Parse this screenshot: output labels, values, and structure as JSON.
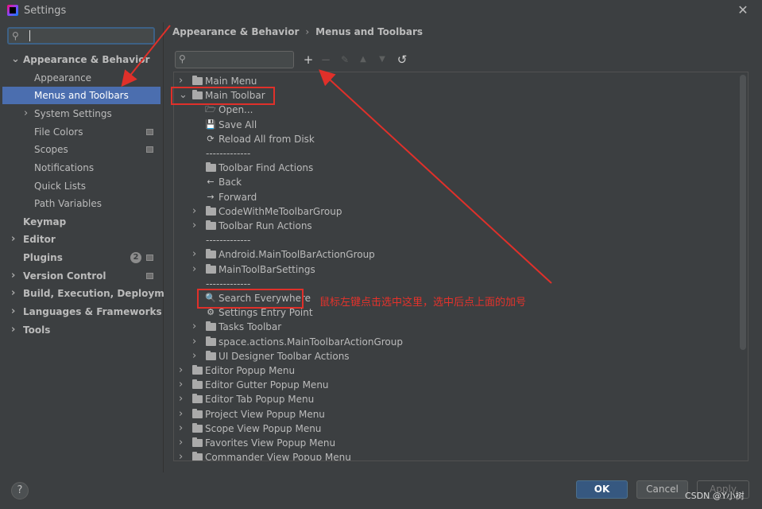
{
  "window": {
    "title": "Settings",
    "close_glyph": "✕"
  },
  "left": {
    "search_icon": "search-icon",
    "nav": [
      {
        "label": "Appearance & Behavior",
        "bold": true,
        "expanded": true
      },
      {
        "label": "Appearance"
      },
      {
        "label": "Menus and Toolbars",
        "selected": true
      },
      {
        "label": "System Settings",
        "collapsed": true
      },
      {
        "label": "File Colors",
        "badge": true
      },
      {
        "label": "Scopes",
        "badge": true
      },
      {
        "label": "Notifications"
      },
      {
        "label": "Quick Lists"
      },
      {
        "label": "Path Variables"
      },
      {
        "label": "Keymap",
        "bold": true
      },
      {
        "label": "Editor",
        "bold": true,
        "collapsed": true
      },
      {
        "label": "Plugins",
        "bold": true,
        "help_badge": "2",
        "badge": true
      },
      {
        "label": "Version Control",
        "bold": true,
        "collapsed": true,
        "badge": true
      },
      {
        "label": "Build, Execution, Deployment",
        "bold": true,
        "collapsed": true
      },
      {
        "label": "Languages & Frameworks",
        "bold": true,
        "collapsed": true
      },
      {
        "label": "Tools",
        "bold": true,
        "collapsed": true
      }
    ]
  },
  "right": {
    "breadcrumb": [
      "Appearance & Behavior",
      "Menus and Toolbars"
    ],
    "breadcrumb_sep": "›",
    "toolbar": {
      "add": "+",
      "remove": "−",
      "edit": "✎",
      "up": "▲",
      "down": "▼",
      "restore": "↺"
    },
    "tree": [
      {
        "label": "Main Menu",
        "level": 0,
        "type": "folder",
        "arrow": "collapsed"
      },
      {
        "label": "Main Toolbar",
        "level": 0,
        "type": "folder",
        "arrow": "expanded"
      },
      {
        "label": "Open...",
        "level": 1,
        "type": "open"
      },
      {
        "label": "Save All",
        "level": 1,
        "type": "save"
      },
      {
        "label": "Reload All from Disk",
        "level": 1,
        "type": "reload"
      },
      {
        "label": "-------------",
        "level": 1,
        "type": "sep"
      },
      {
        "label": "Toolbar Find Actions",
        "level": 1,
        "type": "folder"
      },
      {
        "label": "Back",
        "level": 1,
        "type": "back"
      },
      {
        "label": "Forward",
        "level": 1,
        "type": "forward"
      },
      {
        "label": "CodeWithMeToolbarGroup",
        "level": 1,
        "type": "folder",
        "arrow": "collapsed"
      },
      {
        "label": "Toolbar Run Actions",
        "level": 1,
        "type": "folder",
        "arrow": "collapsed"
      },
      {
        "label": "-------------",
        "level": 1,
        "type": "sep"
      },
      {
        "label": "Android.MainToolBarActionGroup",
        "level": 1,
        "type": "folder",
        "arrow": "collapsed"
      },
      {
        "label": "MainToolBarSettings",
        "level": 1,
        "type": "folder",
        "arrow": "collapsed"
      },
      {
        "label": "-------------",
        "level": 1,
        "type": "sep"
      },
      {
        "label": "Search Everywhere",
        "level": 1,
        "type": "search"
      },
      {
        "label": "Settings Entry Point",
        "level": 1,
        "type": "gear"
      },
      {
        "label": "Tasks Toolbar",
        "level": 1,
        "type": "folder",
        "arrow": "collapsed"
      },
      {
        "label": "space.actions.MainToolbarActionGroup",
        "level": 1,
        "type": "folder",
        "arrow": "collapsed"
      },
      {
        "label": "UI Designer Toolbar Actions",
        "level": 1,
        "type": "folder",
        "arrow": "collapsed"
      },
      {
        "label": "Editor Popup Menu",
        "level": 0,
        "type": "folder",
        "arrow": "collapsed"
      },
      {
        "label": "Editor Gutter Popup Menu",
        "level": 0,
        "type": "folder",
        "arrow": "collapsed"
      },
      {
        "label": "Editor Tab Popup Menu",
        "level": 0,
        "type": "folder",
        "arrow": "collapsed"
      },
      {
        "label": "Project View Popup Menu",
        "level": 0,
        "type": "folder",
        "arrow": "collapsed"
      },
      {
        "label": "Scope View Popup Menu",
        "level": 0,
        "type": "folder",
        "arrow": "collapsed"
      },
      {
        "label": "Favorites View Popup Menu",
        "level": 0,
        "type": "folder",
        "arrow": "collapsed"
      },
      {
        "label": "Commander View Popup Menu",
        "level": 0,
        "type": "folder",
        "arrow": "collapsed"
      }
    ]
  },
  "annotation": {
    "text": "鼠标左键点击选中这里，选中后点上面的加号",
    "color": "#e5322b"
  },
  "bottom": {
    "help": "?",
    "ok": "OK",
    "cancel": "Cancel",
    "apply": "Apply"
  },
  "watermark": "CSDN @Y小树",
  "colors": {
    "background": "#3c3f41",
    "selection": "#4b6eaf",
    "ok_button": "#365880",
    "annotation_red": "#e0302a"
  }
}
